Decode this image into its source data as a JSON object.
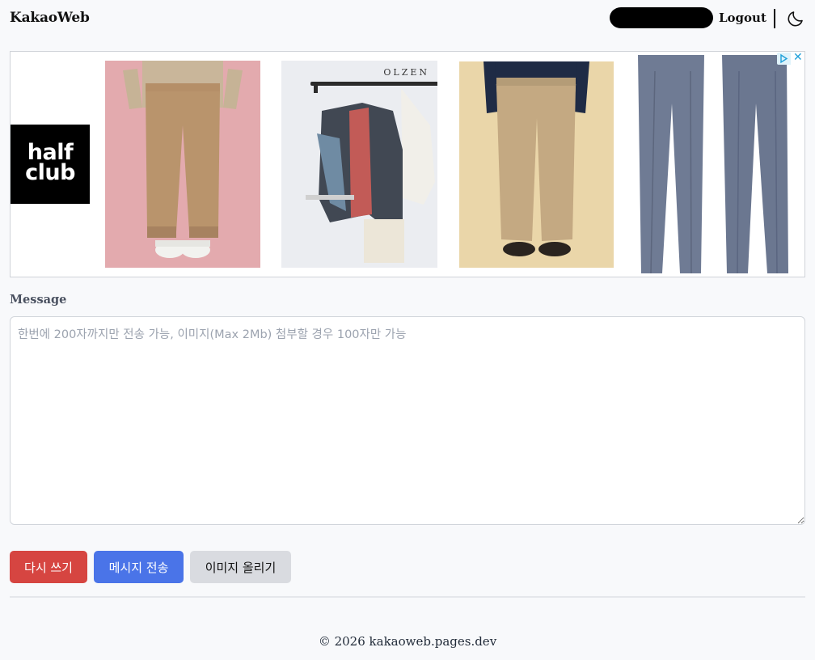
{
  "header": {
    "brand": "KakaoWeb",
    "logout_label": "Logout",
    "theme_icon": "moon-icon"
  },
  "ad": {
    "logo_line1": "half",
    "logo_line2": "club",
    "product2_brand": "OLZEN",
    "choices_icon": "adchoices-icon",
    "close_icon": "close-icon"
  },
  "form": {
    "label": "Message",
    "placeholder": "한번에 200자까지만 전송 가능, 이미지(Max 2Mb) 첨부할 경우 100자만 가능",
    "value": ""
  },
  "buttons": {
    "reset": "다시 쓰기",
    "send": "메시지 전송",
    "upload": "이미지 올리기",
    "reset_color": "#d64541",
    "send_color": "#4a74e8",
    "upload_color": "#d9dbe0"
  },
  "footer": {
    "text": "© 2026 kakaoweb.pages.dev"
  }
}
